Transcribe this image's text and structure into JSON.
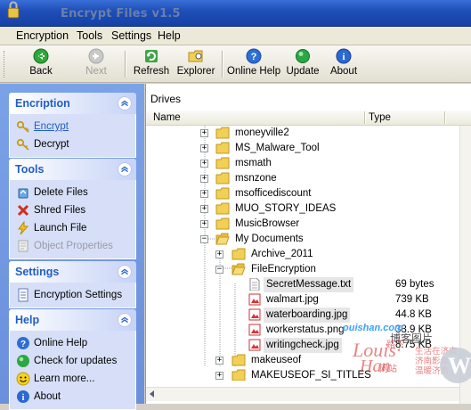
{
  "window": {
    "title": "Encrypt Files v1.5"
  },
  "menu": [
    "Encryption",
    "Tools",
    "Settings",
    "Help"
  ],
  "toolbar": {
    "back": "Back",
    "next": "Next",
    "refresh": "Refresh",
    "explorer": "Explorer",
    "online_help": "Online Help",
    "update": "Update",
    "about": "About"
  },
  "sidebar": {
    "encryption": {
      "title": "Encription",
      "items": [
        "Encrypt",
        "Decrypt"
      ]
    },
    "tools": {
      "title": "Tools",
      "items": [
        "Delete Files",
        "Shred Files",
        "Launch File",
        "Object Properties"
      ]
    },
    "settings": {
      "title": "Settings",
      "items": [
        "Encryption Settings"
      ]
    },
    "help": {
      "title": "Help",
      "items": [
        "Online Help",
        "Check for updates",
        "Learn more...",
        "About"
      ]
    }
  },
  "main": {
    "drives_label": "Drives",
    "columns": {
      "name": "Name",
      "type": "Type"
    },
    "tree": [
      {
        "name": "moneyville2",
        "type": ""
      },
      {
        "name": "MS_Malware_Tool",
        "type": ""
      },
      {
        "name": "msmath",
        "type": ""
      },
      {
        "name": "msnzone",
        "type": ""
      },
      {
        "name": "msofficediscount",
        "type": ""
      },
      {
        "name": "MUO_STORY_IDEAS",
        "type": ""
      },
      {
        "name": "MusicBrowser",
        "type": ""
      },
      {
        "name": "My Documents",
        "type": ""
      },
      {
        "name": "Archive_2011",
        "type": ""
      },
      {
        "name": "FileEncryption",
        "type": ""
      },
      {
        "name": "SecretMessage.txt",
        "type": "69 bytes"
      },
      {
        "name": "walmart.jpg",
        "type": "739 KB"
      },
      {
        "name": "waterboarding.jpg",
        "type": "44.8 KB"
      },
      {
        "name": "workerstatus.png",
        "type": "38.9 KB"
      },
      {
        "name": "writingcheck.jpg",
        "type": "8.75 KB"
      },
      {
        "name": "makeuseof",
        "type": ""
      },
      {
        "name": "MAKEUSEOF_SI_TITLES",
        "type": ""
      }
    ]
  },
  "watermark": {
    "site": "ouishan.com",
    "blog": "博客图片",
    "louis": "Louis·",
    "han": "Han",
    "cn1": "路下",
    "cn2": "网站",
    "motto": [
      "生活在济南",
      "济南影像",
      "温暖济南"
    ],
    "wp": "W"
  },
  "colors": {
    "accent": "#215dc6",
    "titlebar": "#1f4fb8",
    "sidebar_bg": "#7ba2e7"
  }
}
